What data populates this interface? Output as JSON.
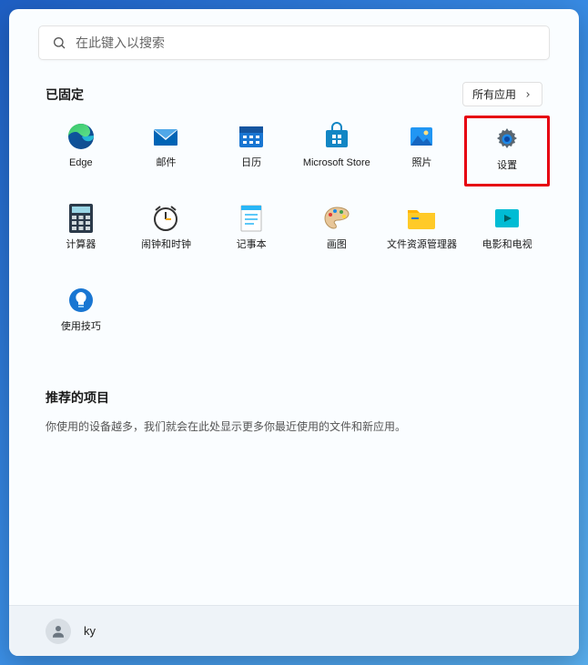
{
  "search": {
    "placeholder": "在此键入以搜索"
  },
  "pinned": {
    "title": "已固定",
    "all_apps_label": "所有应用",
    "apps": [
      {
        "id": "edge",
        "label": "Edge"
      },
      {
        "id": "mail",
        "label": "邮件"
      },
      {
        "id": "calendar",
        "label": "日历"
      },
      {
        "id": "store",
        "label": "Microsoft Store"
      },
      {
        "id": "photos",
        "label": "照片"
      },
      {
        "id": "settings",
        "label": "设置",
        "highlighted": true
      },
      {
        "id": "calculator",
        "label": "计算器"
      },
      {
        "id": "alarms",
        "label": "闹钟和时钟"
      },
      {
        "id": "notepad",
        "label": "记事本"
      },
      {
        "id": "paint",
        "label": "画图"
      },
      {
        "id": "explorer",
        "label": "文件资源管理器"
      },
      {
        "id": "movies",
        "label": "电影和电视"
      },
      {
        "id": "tips",
        "label": "使用技巧"
      }
    ]
  },
  "recommended": {
    "title": "推荐的项目",
    "text": "你使用的设备越多，我们就会在此处显示更多你最近使用的文件和新应用。"
  },
  "user": {
    "name": "ky"
  }
}
